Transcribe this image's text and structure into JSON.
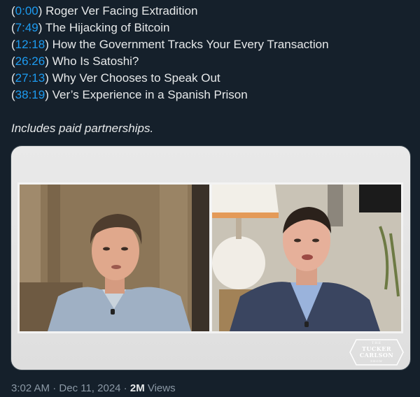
{
  "chapters": [
    {
      "timestamp": "0:00",
      "title": "Roger Ver Facing Extradition"
    },
    {
      "timestamp": "7:49",
      "title": "The Hijacking of Bitcoin"
    },
    {
      "timestamp": "12:18",
      "title": "How the Government Tracks Your Every Transaction"
    },
    {
      "timestamp": "26:26",
      "title": "Who Is Satoshi?"
    },
    {
      "timestamp": "27:13",
      "title": "Why Ver Chooses to Speak Out"
    },
    {
      "timestamp": "38:19",
      "title": "Ver’s Experience in a Spanish Prison"
    }
  ],
  "disclosure": "Includes paid partnerships.",
  "media": {
    "logo": {
      "line1": "THE",
      "line2": "TUCKER",
      "line3": "CARLSON",
      "line4": "SHOW"
    }
  },
  "meta": {
    "time": "3:02 AM",
    "separator": " · ",
    "date": "Dec 11, 2024",
    "views_count": "2M",
    "views_label": " Views"
  },
  "colors": {
    "background": "#15202b",
    "text": "#e7e9ea",
    "link": "#1d9bf0",
    "muted": "#8b98a5"
  }
}
